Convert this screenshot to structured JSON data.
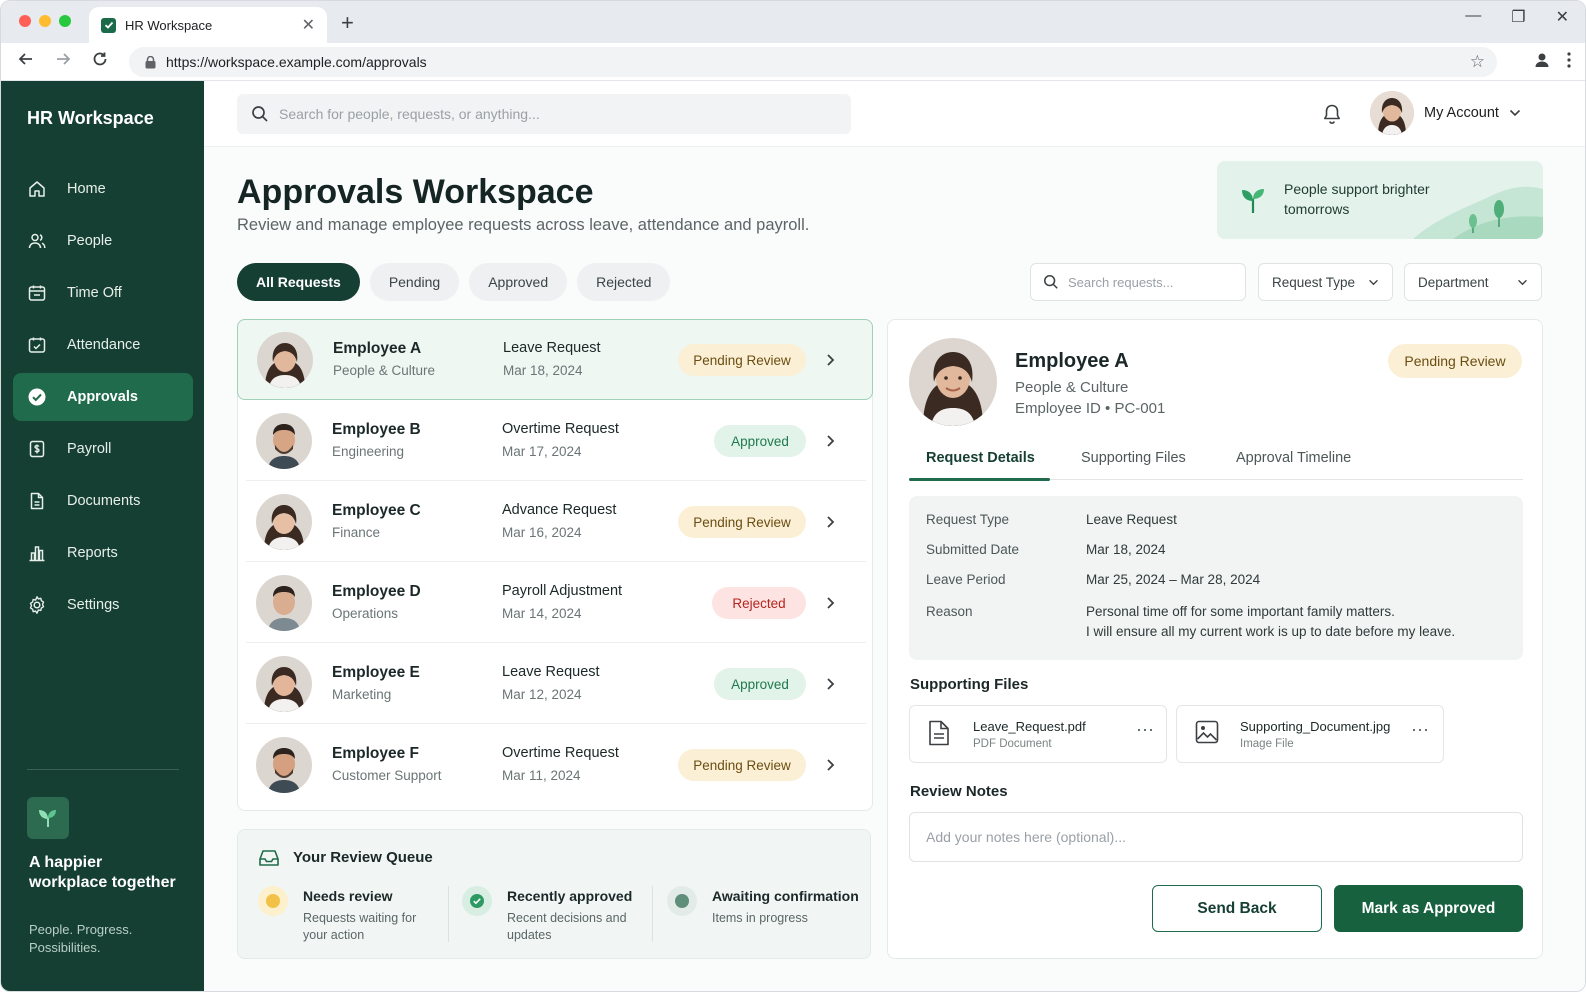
{
  "browser": {
    "tab_title": "HR Workspace",
    "url": "https://workspace.example.com/approvals",
    "traffic": [
      "#ff5f57",
      "#febc2e",
      "#28c840"
    ]
  },
  "sidebar": {
    "brand": "HR Workspace",
    "items": [
      {
        "label": "Home",
        "icon": "home-icon"
      },
      {
        "label": "People",
        "icon": "people-icon"
      },
      {
        "label": "Time Off",
        "icon": "time-off-icon"
      },
      {
        "label": "Attendance",
        "icon": "calendar-icon"
      },
      {
        "label": "Approvals",
        "icon": "check-circle-icon",
        "active": true
      },
      {
        "label": "Payroll",
        "icon": "payroll-icon"
      },
      {
        "label": "Documents",
        "icon": "document-icon"
      },
      {
        "label": "Reports",
        "icon": "bar-chart-icon"
      },
      {
        "label": "Settings",
        "icon": "gear-icon"
      }
    ],
    "tagline": "A happier workplace together",
    "tagline_sub": "People. Progress. Possibilities."
  },
  "topbar": {
    "search_placeholder": "Search for people, requests, or anything...",
    "account_label": "My Account"
  },
  "header": {
    "title": "Approvals Workspace",
    "subtitle": "Review and manage employee requests across leave, attendance and payroll.",
    "promo": "People support brighter tomorrows"
  },
  "filters": {
    "pills": [
      "All Requests",
      "Pending",
      "Approved",
      "Rejected"
    ],
    "search_placeholder": "Search requests...",
    "request_type": "Request Type",
    "department": "Department"
  },
  "requests": [
    {
      "name": "Employee A",
      "dept": "People & Culture",
      "type": "Leave Request",
      "date": "Mar 18, 2024",
      "status": "Pending Review",
      "kind": "pend"
    },
    {
      "name": "Employee B",
      "dept": "Engineering",
      "type": "Overtime Request",
      "date": "Mar 17, 2024",
      "status": "Approved",
      "kind": "appr"
    },
    {
      "name": "Employee C",
      "dept": "Finance",
      "type": "Advance Request",
      "date": "Mar 16, 2024",
      "status": "Pending Review",
      "kind": "pend"
    },
    {
      "name": "Employee D",
      "dept": "Operations",
      "type": "Payroll Adjustment",
      "date": "Mar 14, 2024",
      "status": "Rejected",
      "kind": "rej"
    },
    {
      "name": "Employee E",
      "dept": "Marketing",
      "type": "Leave Request",
      "date": "Mar 12, 2024",
      "status": "Approved",
      "kind": "appr"
    },
    {
      "name": "Employee F",
      "dept": "Customer Support",
      "type": "Overtime Request",
      "date": "Mar 11, 2024",
      "status": "Pending Review",
      "kind": "pend"
    }
  ],
  "queue": {
    "title": "Your Review Queue",
    "items": [
      {
        "head": "Needs review",
        "sub": "Requests waiting for your action"
      },
      {
        "head": "Recently approved",
        "sub": "Recent decisions and updates"
      },
      {
        "head": "Awaiting confirmation",
        "sub": "Items in progress"
      }
    ]
  },
  "detail": {
    "name": "Employee A",
    "dept": "People & Culture",
    "id_line": "Employee ID  •  PC-001",
    "status": "Pending Review",
    "tabs": [
      "Request Details",
      "Supporting Files",
      "Approval Timeline"
    ],
    "facts": [
      {
        "label": "Request Type",
        "value": "Leave Request"
      },
      {
        "label": "Submitted Date",
        "value": "Mar 18, 2024"
      },
      {
        "label": "Leave Period",
        "value": "Mar 25, 2024 – Mar 28, 2024"
      },
      {
        "label": "Reason",
        "value": "Personal time off for some important family matters.",
        "value2": "I will ensure all my current work is up to date before my leave."
      }
    ],
    "files_title": "Supporting Files",
    "files": [
      {
        "name": "Leave_Request.pdf",
        "type": "PDF Document",
        "icon": "file-icon"
      },
      {
        "name": "Supporting_Document.jpg",
        "type": "Image File",
        "icon": "image-icon"
      }
    ],
    "notes_title": "Review Notes",
    "notes_placeholder": "Add your notes here (optional)...",
    "send_back": "Send Back",
    "approve": "Mark as Approved"
  },
  "colors": {
    "sidebar": "#163f33",
    "accent": "#1f6b4b",
    "pending_bg": "#fbf0d5",
    "approved_bg": "#e2f3ea",
    "rejected_bg": "#fde3e1"
  }
}
